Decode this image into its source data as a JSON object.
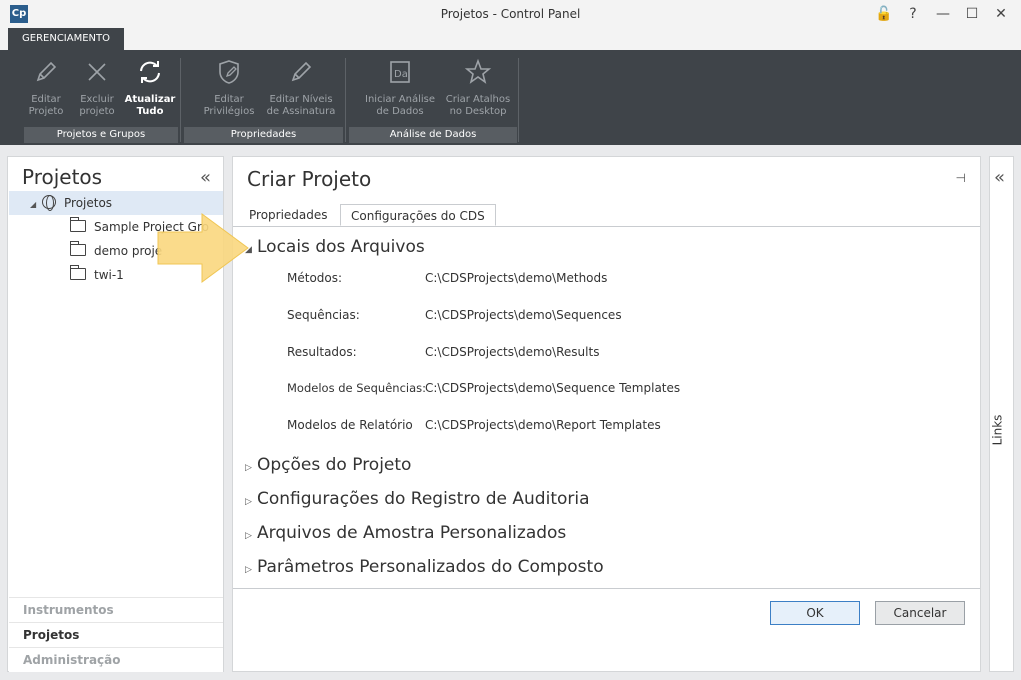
{
  "window": {
    "title": "Projetos - Control Panel",
    "app_icon_text": "Cp",
    "controls": {
      "lock": "🔓",
      "help": "?",
      "minimize": "—",
      "maximize": "☐",
      "close": "✕"
    }
  },
  "ribbon": {
    "tab": "GERENCIAMENTO",
    "buttons": {
      "editar_projeto": "Editar\nProjeto",
      "excluir_projeto": "Excluir\nprojeto",
      "atualizar_tudo": "Atualizar\nTudo",
      "editar_privilegios": "Editar\nPrivilégios",
      "editar_niveis": "Editar Níveis\nde Assinatura",
      "iniciar_analise": "Iniciar Análise\nde Dados",
      "criar_atalhos": "Criar Atalhos\nno Desktop"
    },
    "groups": {
      "projetos_grupos": "Projetos e Grupos",
      "propriedades": "Propriedades",
      "analise_dados": "Análise de Dados"
    }
  },
  "left_panel": {
    "title": "Projetos",
    "collapse_glyph": "«",
    "tree": {
      "root": "Projetos",
      "children": [
        "Sample Project Gro",
        "demo proje",
        "twi-1"
      ]
    },
    "nav": {
      "instrumentos": "Instrumentos",
      "projetos": "Projetos",
      "administracao": "Administração"
    }
  },
  "main_panel": {
    "title": "Criar Projeto",
    "pin_glyph": "⊣",
    "tabs": {
      "propriedades": "Propriedades",
      "configuracoes_cds": "Configurações do CDS"
    },
    "sections": {
      "locais": "Locais dos Arquivos",
      "opcoes": "Opções do Projeto",
      "auditoria": "Configurações do Registro de Auditoria",
      "amostra": "Arquivos de Amostra Personalizados",
      "parametros": "Parâmetros Personalizados do Composto"
    },
    "fields": [
      {
        "label": "Métodos:",
        "value": "C:\\CDSProjects\\demo\\Methods"
      },
      {
        "label": "Sequências:",
        "value": "C:\\CDSProjects\\demo\\Sequences"
      },
      {
        "label": "Resultados:",
        "value": "C:\\CDSProjects\\demo\\Results"
      },
      {
        "label": "Modelos de Sequências:",
        "value": "C:\\CDSProjects\\demo\\Sequence Templates"
      },
      {
        "label": "Modelos de Relatório",
        "value": "C:\\CDSProjects\\demo\\Report Templates"
      }
    ],
    "buttons": {
      "ok": "OK",
      "cancel": "Cancelar"
    }
  },
  "links_panel": {
    "label": "Links",
    "collapse_glyph": "«"
  },
  "colors": {
    "ribbon_bg": "#3f4449",
    "selection_bg": "#dfe9f5",
    "arrow": "#f9d77e"
  }
}
